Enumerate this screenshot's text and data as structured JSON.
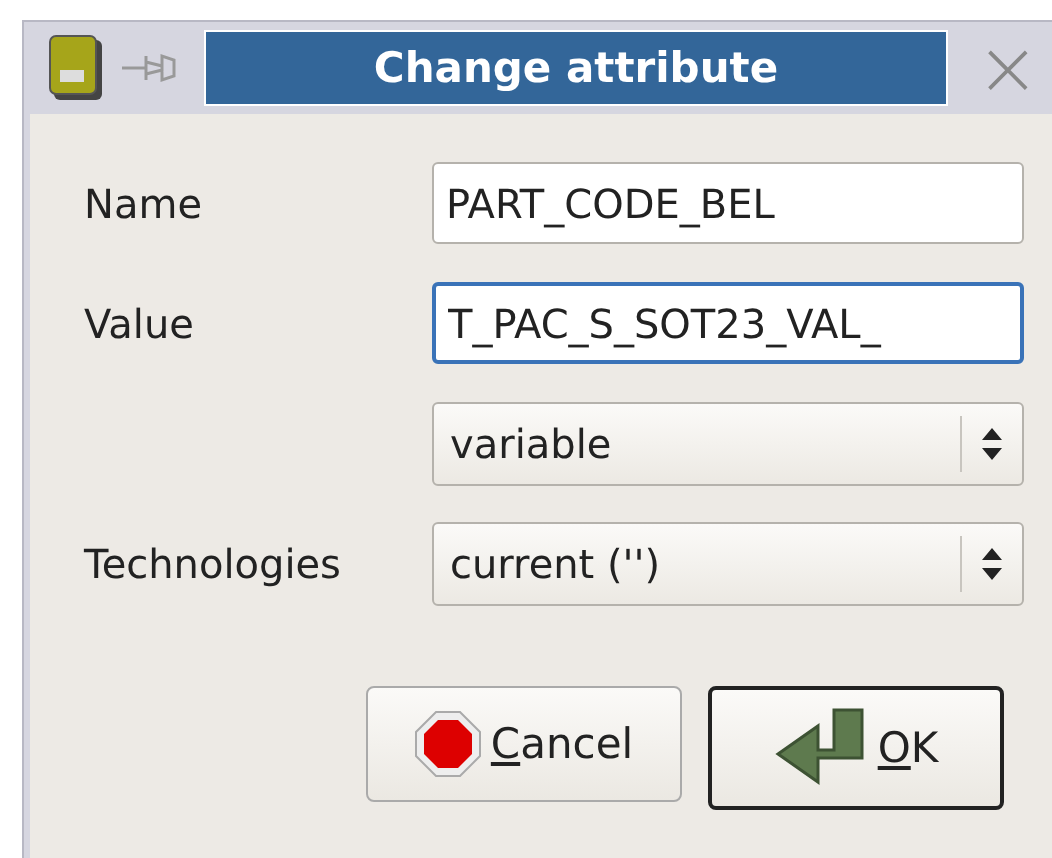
{
  "window": {
    "title": "Change attribute",
    "close": "×"
  },
  "fields": [
    {
      "kind": "text",
      "label": "Name",
      "value": "PART_CODE_BEL",
      "focused": false
    },
    {
      "kind": "text",
      "label": "Value",
      "value": "T_PAC_S_SOT23_VAL_",
      "focused": true
    },
    {
      "kind": "select",
      "value": "variable"
    },
    {
      "kind": "select",
      "label": "Technologies",
      "value": "current ('')"
    }
  ],
  "buttons": [
    {
      "kind": "cancel",
      "label": "Cancel",
      "mnemonic_underlined": true,
      "default": false
    },
    {
      "kind": "ok",
      "label": "OK",
      "mnemonic_underlined": true,
      "default": true
    }
  ]
}
